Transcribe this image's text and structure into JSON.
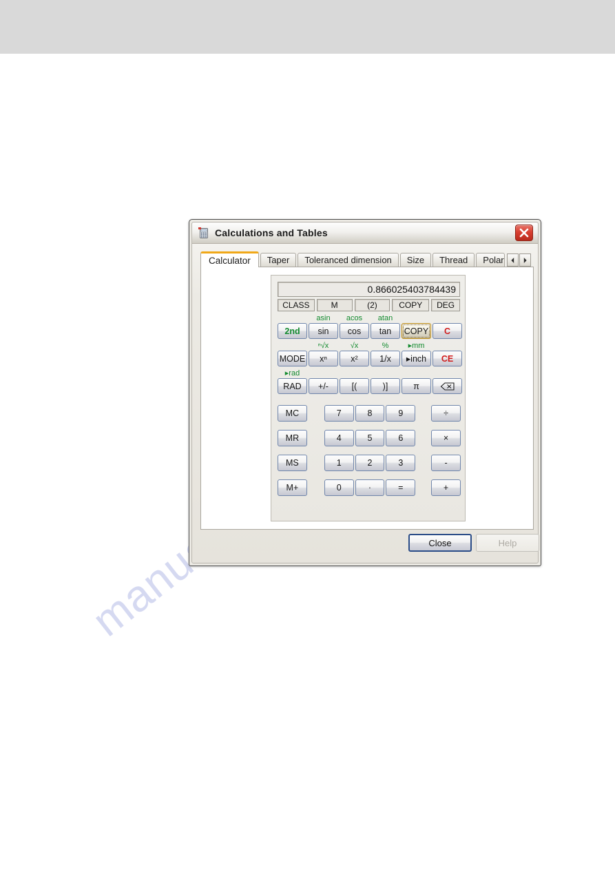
{
  "window": {
    "title": "Calculations and Tables",
    "icon": "calculator-icon",
    "close_label": "×"
  },
  "tabs": [
    {
      "label": "Calculator",
      "active": true
    },
    {
      "label": "Taper",
      "active": false
    },
    {
      "label": "Toleranced dimension",
      "active": false
    },
    {
      "label": "Size",
      "active": false
    },
    {
      "label": "Thread",
      "active": false
    },
    {
      "label": "Polar",
      "active": false
    }
  ],
  "tab_scroll": {
    "prev": "◄",
    "next": "►"
  },
  "calculator": {
    "display_value": "0.866025403784439",
    "status": [
      {
        "name": "class",
        "label": "CLASS"
      },
      {
        "name": "memory",
        "label": "M"
      },
      {
        "name": "parenthesis-level",
        "label": "(2)"
      },
      {
        "name": "copy",
        "label": "COPY"
      },
      {
        "name": "angle-unit",
        "label": "DEG"
      }
    ],
    "rows": [
      {
        "name": "trig-row",
        "keys": [
          {
            "name": "second-function",
            "label": "2nd",
            "shift": "",
            "style": "green"
          },
          {
            "name": "sin",
            "label": "sin",
            "shift": "asin",
            "style": "normal"
          },
          {
            "name": "cos",
            "label": "cos",
            "shift": "acos",
            "style": "normal"
          },
          {
            "name": "tan",
            "label": "tan",
            "shift": "atan",
            "style": "normal"
          },
          {
            "name": "copy",
            "label": "COPY",
            "shift": "",
            "style": "focused"
          },
          {
            "name": "clear",
            "label": "C",
            "shift": "",
            "style": "red"
          }
        ]
      },
      {
        "name": "power-row",
        "keys": [
          {
            "name": "mode",
            "label": "MODE",
            "shift": "",
            "style": "normal"
          },
          {
            "name": "x-power-n",
            "label": "xⁿ",
            "shift": "ⁿ√x",
            "style": "normal"
          },
          {
            "name": "x-squared",
            "label": "x²",
            "shift": "√x",
            "style": "normal"
          },
          {
            "name": "reciprocal",
            "label": "1/x",
            "shift": "%",
            "style": "normal"
          },
          {
            "name": "to-inch",
            "label": "▸inch",
            "shift": "▸mm",
            "style": "normal"
          },
          {
            "name": "clear-entry",
            "label": "CE",
            "shift": "",
            "style": "red"
          }
        ]
      },
      {
        "name": "rad-row",
        "keys": [
          {
            "name": "rad",
            "label": "RAD",
            "shift": "▸rad",
            "style": "normal"
          },
          {
            "name": "plus-minus",
            "label": "+/-",
            "shift": "",
            "style": "normal"
          },
          {
            "name": "open-bracket",
            "label": "[(",
            "shift": "",
            "style": "normal"
          },
          {
            "name": "close-bracket",
            "label": ")]",
            "shift": "",
            "style": "normal"
          },
          {
            "name": "pi",
            "label": "π",
            "shift": "",
            "style": "normal"
          },
          {
            "name": "backspace",
            "label": "",
            "shift": "",
            "style": "icon-backspace"
          }
        ]
      }
    ],
    "numpad": [
      {
        "memory": "MC",
        "digits": [
          "7",
          "8",
          "9"
        ],
        "operator": "÷"
      },
      {
        "memory": "MR",
        "digits": [
          "4",
          "5",
          "6"
        ],
        "operator": "×"
      },
      {
        "memory": "MS",
        "digits": [
          "1",
          "2",
          "3"
        ],
        "operator": "-"
      },
      {
        "memory": "M+",
        "digits": [
          "0",
          "·",
          "="
        ],
        "operator": "+"
      }
    ]
  },
  "buttons": {
    "close": "Close",
    "help": "Help"
  },
  "watermark": "manualslib.com",
  "colors": {
    "accent_tab": "#f0a818",
    "green_label": "#128a2e",
    "red_label": "#d01b1b",
    "close_button": "#d83f30"
  }
}
